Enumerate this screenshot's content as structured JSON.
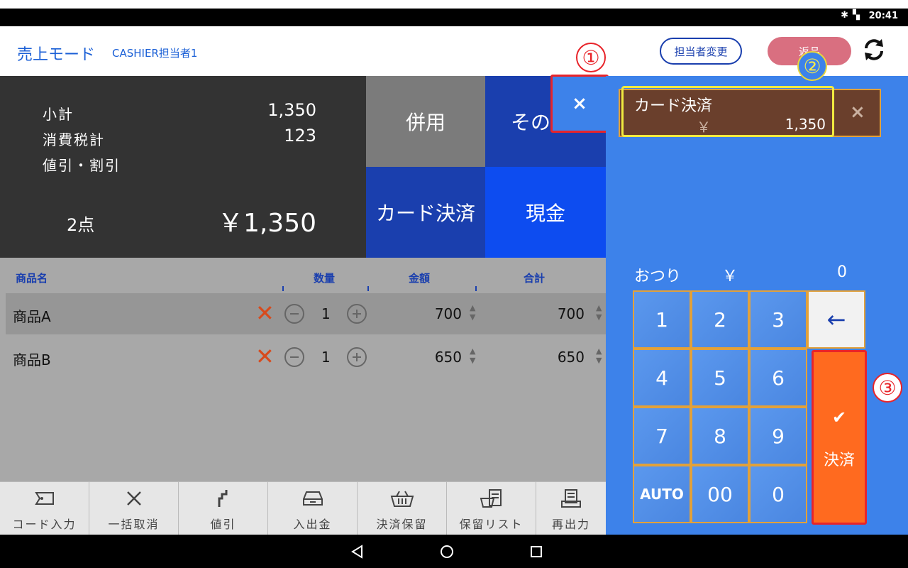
{
  "status": {
    "time": "20:41",
    "icons": [
      "bluetooth-icon",
      "no-sim-icon"
    ]
  },
  "appbar": {
    "title": "売上モード",
    "cashier": "CASHIER担当者1",
    "change_staff": "担当者変更",
    "return_label": "返品"
  },
  "summary": {
    "subtotal_label": "小計",
    "subtotal": "1,350",
    "tax_label": "消費税計",
    "tax": "123",
    "discount_label": "値引・割引",
    "count": "2点",
    "total": "￥1,350"
  },
  "pay_tiles": {
    "combined": "併用",
    "other": "その他",
    "close_x": "×",
    "card": "カード決済",
    "cash": "現金"
  },
  "table": {
    "headers": [
      "商品名",
      "数量",
      "金額",
      "合計"
    ],
    "rows": [
      {
        "name": "商品A",
        "qty": "1",
        "price": "700",
        "total": "700"
      },
      {
        "name": "商品B",
        "qty": "1",
        "price": "650",
        "total": "650"
      }
    ]
  },
  "toolbar": [
    {
      "label": "コード入力",
      "icon": "tag-icon"
    },
    {
      "label": "一括取消",
      "icon": "close-icon"
    },
    {
      "label": "値引",
      "icon": "discount-stairs-icon"
    },
    {
      "label": "入出金",
      "icon": "drawer-icon"
    },
    {
      "label": "決済保留",
      "icon": "basket-icon"
    },
    {
      "label": "保留リスト",
      "icon": "hold-list-icon"
    },
    {
      "label": "再出力",
      "icon": "receipt-icon"
    }
  ],
  "payment_entry": {
    "method": "カード決済",
    "currency": "￥",
    "amount": "1,350",
    "remove": "×"
  },
  "change": {
    "label": "おつり",
    "currency": "￥",
    "amount": "0"
  },
  "keypad": {
    "keys": [
      "1",
      "2",
      "3",
      "4",
      "5",
      "6",
      "7",
      "8",
      "9",
      "AUTO",
      "00",
      "0"
    ],
    "backspace": "←",
    "settle_check": "✔",
    "settle": "決済"
  },
  "annotations": [
    "①",
    "②",
    "③"
  ],
  "colors": {
    "accent": "#1a5fd6",
    "panel_blue": "#3d82ea",
    "settle_orange": "#ff6a1f",
    "callout_red": "#e8242a",
    "callout_yellow": "#f0ea40"
  }
}
